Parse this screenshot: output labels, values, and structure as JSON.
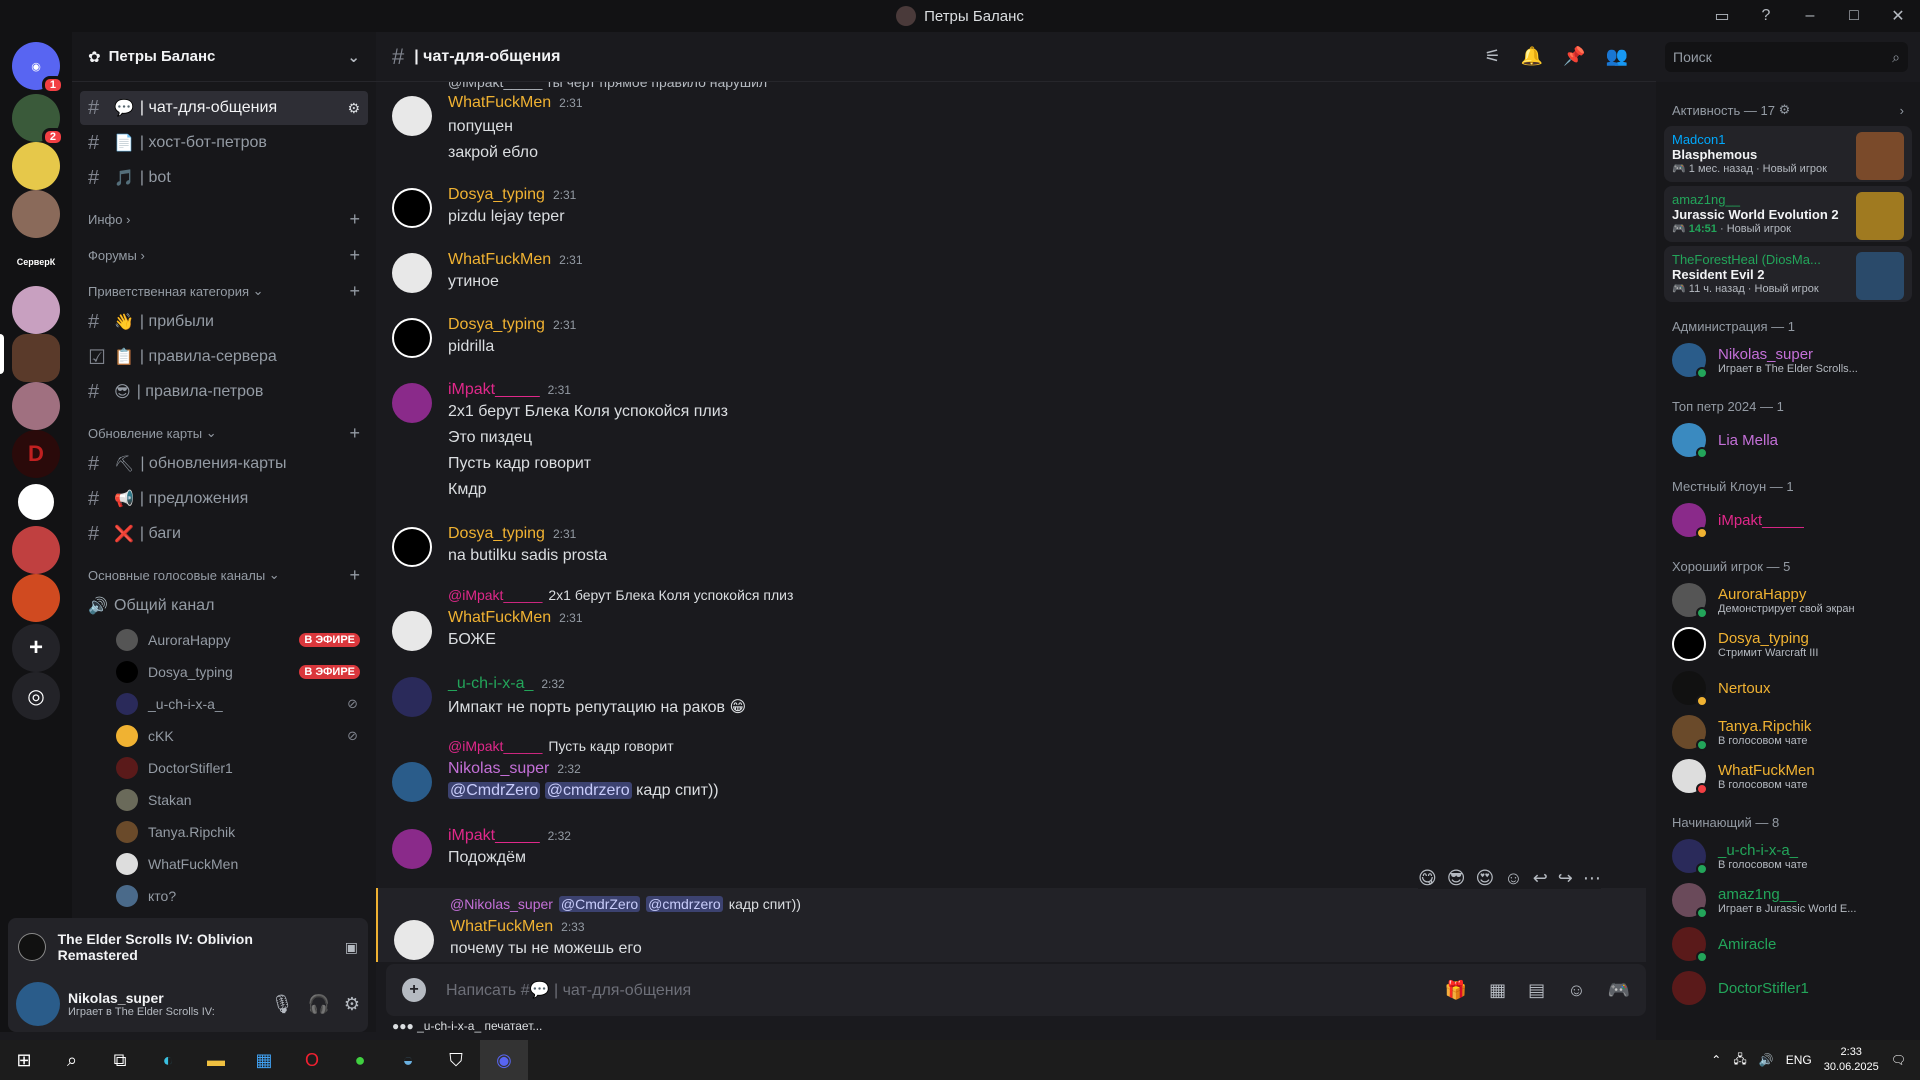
{
  "window": {
    "title": "Петры Баланс"
  },
  "guilds": [
    {
      "label": "",
      "badge": "1",
      "color": "#5865f2"
    },
    {
      "label": "",
      "badge": "2",
      "color": "#3a5a3a"
    },
    {
      "label": "",
      "badge": "",
      "color": "#e6c84a"
    },
    {
      "label": "",
      "badge": "",
      "color": "#8a6a5a"
    },
    {
      "label": "СерверК",
      "badge": "",
      "color": "#121214"
    },
    {
      "label": "",
      "badge": "",
      "color": "#c8a0c0"
    },
    {
      "label": "",
      "badge": "",
      "color": "#5a3a2a"
    },
    {
      "label": "",
      "badge": "",
      "color": "#a07080"
    },
    {
      "label": "D",
      "badge": "",
      "color": "#2a0a0a"
    },
    {
      "label": "",
      "badge": "",
      "color": "#ffffff"
    },
    {
      "label": "",
      "badge": "",
      "color": "#c04040"
    },
    {
      "label": "",
      "badge": "",
      "color": "#d04a20"
    }
  ],
  "server": {
    "name": "Петры Баланс"
  },
  "channels": {
    "top": [
      {
        "name": "| чат-для-общения",
        "emoji": "💬",
        "active": true
      },
      {
        "name": "| хост-бот-петров",
        "emoji": "📄"
      },
      {
        "name": "| bot",
        "emoji": "🎵"
      }
    ],
    "cat_info": "Инфо",
    "cat_forums": "Форумы",
    "cat_welcome": "Приветственная категория",
    "welcome": [
      {
        "name": "| прибыли",
        "emoji": "👋"
      },
      {
        "name": "| правила-сервера",
        "emoji": "📋"
      },
      {
        "name": "| правила-петров",
        "emoji": "😎"
      }
    ],
    "cat_map": "Обновление карты",
    "map": [
      {
        "name": "| обновления-карты",
        "emoji": "⛏"
      },
      {
        "name": "| предложения",
        "emoji": "📢"
      },
      {
        "name": "| баги",
        "emoji": "❌"
      }
    ],
    "cat_voice": "Основные голосовые каналы",
    "voice_channel": "Общий канал",
    "voice_users": [
      {
        "name": "AuroraHappy",
        "live": "В ЭФИРЕ"
      },
      {
        "name": "Dosya_typing",
        "live": "В ЭФИРЕ"
      },
      {
        "name": "_u-ch-i-x-a_",
        "live": ""
      },
      {
        "name": "cKK",
        "live": ""
      },
      {
        "name": "DoctorStifler1",
        "live": ""
      },
      {
        "name": "Stakan",
        "live": ""
      },
      {
        "name": "Tanya.Ripchik",
        "live": ""
      },
      {
        "name": "WhatFuckMen",
        "live": ""
      },
      {
        "name": "кто?",
        "live": ""
      }
    ]
  },
  "voicebar": {
    "game": "The Elder Scrolls IV: Oblivion Remastered"
  },
  "userbar": {
    "name": "Nikolas_super",
    "status": "Играет в The Elder Scrolls IV:"
  },
  "channel_header": {
    "name": "| чат-для-общения"
  },
  "search": {
    "placeholder": "Поиск"
  },
  "messages": {
    "m0_reply": "@iMpakt_____ ты черт прямое правило нарушил",
    "m1_name": "WhatFuckMen",
    "m1_time": "2:31",
    "m1_l1": "попущен",
    "m1_l2": "закрой ебло",
    "m2_name": "Dosya_typing",
    "m2_time": "2:31",
    "m2_l1": "pizdu lejay teper",
    "m3_name": "WhatFuckMen",
    "m3_time": "2:31",
    "m3_l1": "утиное",
    "m4_name": "Dosya_typing",
    "m4_time": "2:31",
    "m4_l1": "pidrilla",
    "m5_name": "iMpakt_____",
    "m5_time": "2:31",
    "m5_l1": "2х1 берут Блека Коля успокойся плиз",
    "m5_l2": "Это пиздец",
    "m5_l3": "Пусть кадр говорит",
    "m5_l4": "Кмдр",
    "m6_name": "Dosya_typing",
    "m6_time": "2:31",
    "m6_l1": "na butilku sadis prosta",
    "m7_reply_user": "@iMpakt_____",
    "m7_reply_text": "2х1 берут Блека Коля успокойся плиз",
    "m7_name": "WhatFuckMen",
    "m7_time": "2:31",
    "m7_l1": "БОЖЕ",
    "m8_name": "_u-ch-i-x-a_",
    "m8_time": "2:32",
    "m8_l1": "Импакт не порть репутацию на раков",
    "m9_reply_user": "@iMpakt_____",
    "m9_reply_text": "Пусть кадр говорит",
    "m9_name": "Nikolas_super",
    "m9_time": "2:32",
    "m9_mention1": "@CmdrZero",
    "m9_mention2": "@cmdrzero",
    "m9_text": "кадр спит))",
    "m10_name": "iMpakt_____",
    "m10_time": "2:32",
    "m10_l1": "Подождём",
    "m11_reply_user": "@Nikolas_super",
    "m11_mention1": "@CmdrZero",
    "m11_mention2": "@cmdrzero",
    "m11_reply_text": "кадр спит))",
    "m11_name": "WhatFuckMen",
    "m11_time": "2:33",
    "m11_l1": "почему ты не можешь его"
  },
  "composer": {
    "placeholder": "Написать #💬 | чат-для-общения"
  },
  "typing": "_u-ch-i-x-a_ печатает...",
  "members": {
    "activity_title": "Активность — 17",
    "activities": [
      {
        "user": "Madcon1",
        "user_color": "#00a8fc",
        "game": "Blasphemous",
        "meta": "1 мес. назад",
        "tag": "Новый игрок",
        "art": "#7a4a2a"
      },
      {
        "user": "amaz1ng__",
        "user_color": "#23a55a",
        "game": "Jurassic World Evolution 2",
        "meta": "14:51",
        "tag": "Новый игрок",
        "art": "#a07a20"
      },
      {
        "user": "TheForestHeal (DiosMa...",
        "user_color": "#23a55a",
        "game": "Resident Evil 2",
        "meta": "11 ч. назад",
        "tag": "Новый игрок",
        "art": "#2a4a6a"
      }
    ],
    "cat_admin": "Администрация — 1",
    "admin": [
      {
        "name": "Nikolas_super",
        "status": "Играет в The Elder Scrolls...",
        "color": "#c470d8"
      }
    ],
    "cat_top": "Топ петр 2024 — 1",
    "top": [
      {
        "name": "Lia Mella",
        "status": "",
        "color": "#c470d8"
      }
    ],
    "cat_clown": "Местный Клоун — 1",
    "clown": [
      {
        "name": "iMpakt_____",
        "status": "",
        "color": "#e0288a"
      }
    ],
    "cat_good": "Хороший игрок — 5",
    "good": [
      {
        "name": "AuroraHappy",
        "status": "Демонстрирует свой экран",
        "color": "#f0b232"
      },
      {
        "name": "Dosya_typing",
        "status": "Стримит Warcraft III",
        "color": "#f0b232"
      },
      {
        "name": "Nertoux",
        "status": "",
        "color": "#f0b232"
      },
      {
        "name": "Tanya.Ripchik",
        "status": "В голосовом чате",
        "color": "#f0b232"
      },
      {
        "name": "WhatFuckMen",
        "status": "В голосовом чате",
        "color": "#f0b232"
      }
    ],
    "cat_new": "Начинающий — 8",
    "new": [
      {
        "name": "_u-ch-i-x-a_",
        "status": "В голосовом чате",
        "color": "#23a55a"
      },
      {
        "name": "amaz1ng__",
        "status": "Играет в Jurassic World E...",
        "color": "#23a55a"
      },
      {
        "name": "Amiracle",
        "status": "",
        "color": "#23a55a"
      },
      {
        "name": "DoctorStifler1",
        "status": "",
        "color": "#23a55a"
      }
    ]
  },
  "taskbar": {
    "lang": "ENG",
    "time": "2:33",
    "date": "30.06.2025"
  }
}
